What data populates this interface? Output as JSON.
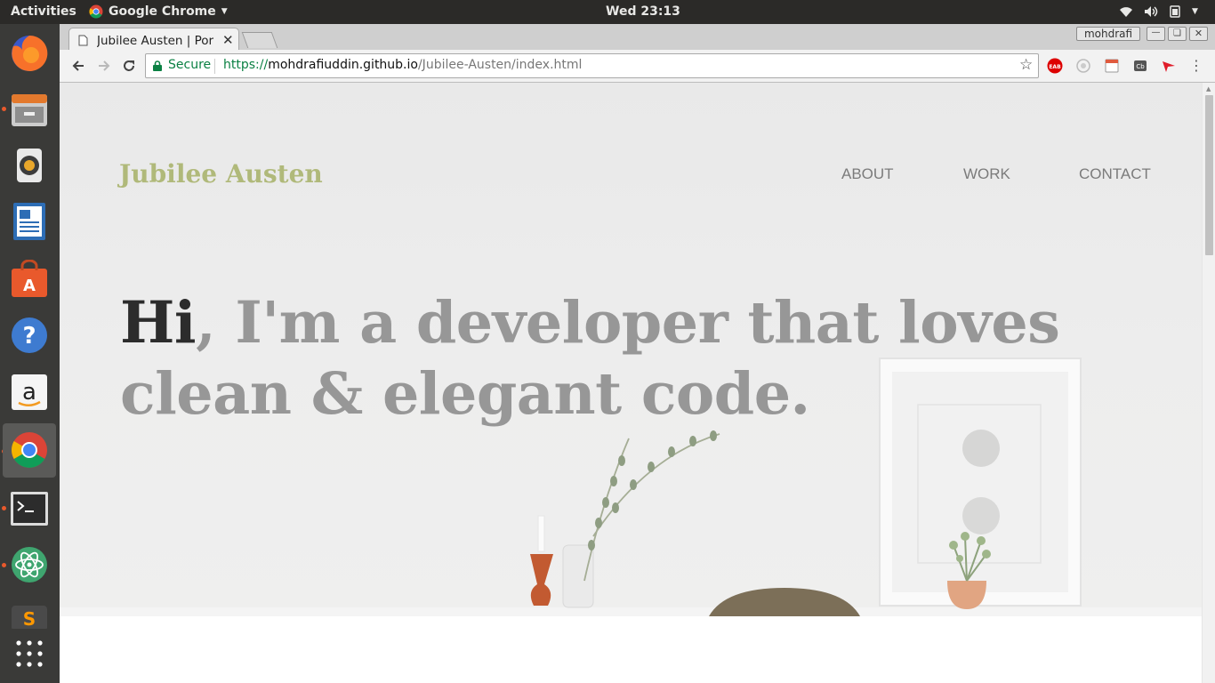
{
  "system": {
    "activities": "Activities",
    "app_name": "Google Chrome",
    "clock": "Wed 23:13"
  },
  "browser": {
    "tab_title": "Jubilee Austen | Por",
    "profile": "mohdrafi",
    "secure_label": "Secure",
    "url_scheme": "https://",
    "url_host": "mohdrafiuddin.github.io",
    "url_path": "/Jubilee-Austen/index.html",
    "extensions": [
      "adblock-icon",
      "extension-icon",
      "extension-icon",
      "extension-icon",
      "extension-icon"
    ]
  },
  "dock": {
    "items": [
      "firefox",
      "files",
      "rhythmbox",
      "libreoffice-writer",
      "software-center",
      "help",
      "amazon",
      "chrome",
      "terminal",
      "atom",
      "sublime",
      "show-apps"
    ]
  },
  "site": {
    "brand": "Jubilee Austen",
    "nav": [
      "ABOUT",
      "WORK",
      "CONTACT"
    ],
    "headline_em": "Hi",
    "headline_rest_1": ", I'm a developer that loves",
    "headline_rest_2": "clean & elegant code.",
    "accent_color": "#b0b97a"
  }
}
